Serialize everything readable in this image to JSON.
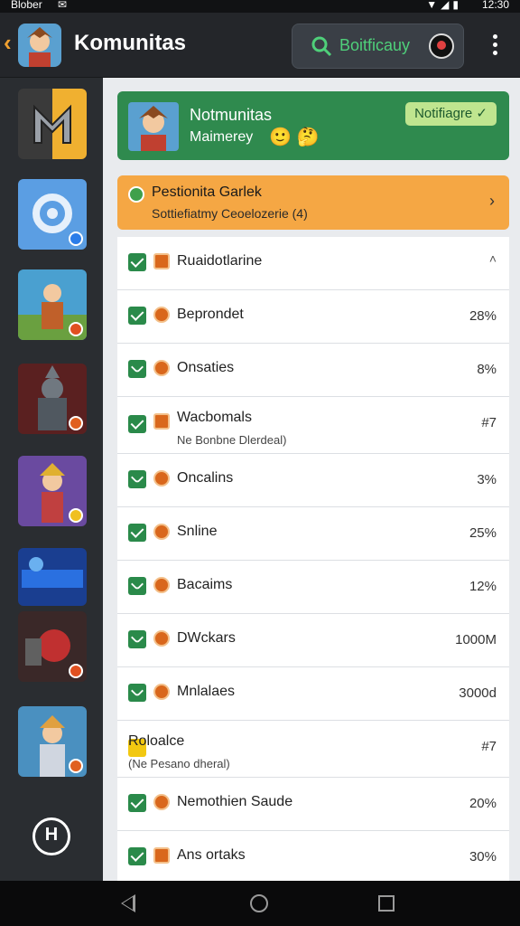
{
  "status_bar": {
    "carrier": "Blober",
    "message_icon": "message-icon",
    "icons": "wifi-icon signal-icon battery-icon",
    "time": "12:30"
  },
  "app_bar": {
    "title": "Komunitas",
    "search_label": "Boitficauy",
    "accent_color": "#f0a030"
  },
  "sidebar": {
    "items": [
      {
        "name": "game-m-icon",
        "colors": [
          "#3a3a3a",
          "#f0b030"
        ]
      },
      {
        "name": "gear-app-icon",
        "colors": [
          "#4a90d9",
          "#bcd7f4"
        ],
        "badge": "#2b7de9"
      },
      {
        "name": "warrior-game-icon",
        "colors": [
          "#4aa0d0",
          "#c0602a"
        ],
        "badge": "#e05020"
      },
      {
        "name": "armor-game-icon",
        "colors": [
          "#5a2020",
          "#c04030"
        ],
        "badge": "#e06020"
      },
      {
        "name": "hero-game-icon",
        "colors": [
          "#6a4aa0",
          "#e08040"
        ],
        "badge": "#f0c020"
      },
      {
        "name": "blue-game-icon",
        "colors": [
          "#1a4aa0",
          "#2a70e0"
        ]
      },
      {
        "name": "mech-game-icon",
        "colors": [
          "#3a2020",
          "#c03030"
        ],
        "badge": "#e05020"
      },
      {
        "name": "knight-game-icon",
        "colors": [
          "#4a90c0",
          "#e0a040"
        ],
        "badge": "#e06020"
      }
    ]
  },
  "banner": {
    "title": "Notmunitas",
    "subtitle": "Maimerey",
    "emoji": "🙂 🤔",
    "button": "Notifiagre ✓",
    "color": "#2f8a4e"
  },
  "promo": {
    "title": "Pestionita Garlek",
    "subtitle": "Sottiefiatmy Ceoelozerie (4)",
    "arrow": "›",
    "color": "#f5a744"
  },
  "list": [
    {
      "label": "Ruaidotlarine",
      "value": "˄",
      "check": "check",
      "icon": "square",
      "header": true
    },
    {
      "label": "Beprondet",
      "value": "28%",
      "check": "check",
      "icon": "round"
    },
    {
      "label": "Onsaties",
      "value": "8%",
      "check": "leaf",
      "icon": "round"
    },
    {
      "label": "Wacbomals",
      "sublabel": "Ne Bonbne Dlerdeal)",
      "value": "#7",
      "check": "check",
      "icon": "square",
      "tall": true
    },
    {
      "label": "Oncalins",
      "value": "3%",
      "check": "leaf",
      "icon": "round"
    },
    {
      "label": "Snline",
      "value": "25%",
      "check": "check",
      "icon": "round"
    },
    {
      "label": "Bacaims",
      "value": "12%",
      "check": "leaf",
      "icon": "round"
    },
    {
      "label": "DWckars",
      "value": "1000M",
      "check": "leaf",
      "icon": "round"
    },
    {
      "label": "Mnlalaes",
      "value": "3000d",
      "check": "leaf",
      "icon": "round"
    },
    {
      "label": "Roloalce",
      "sublabel": "(Ne Pesano dheral)",
      "value": "#7",
      "check": "yellow",
      "icon": "none",
      "tall": true
    },
    {
      "label": "Nemothien Saude",
      "value": "20%",
      "check": "check",
      "icon": "round"
    },
    {
      "label": "Ans ortaks",
      "value": "30%",
      "check": "check",
      "icon": "square"
    }
  ],
  "nav": {
    "back": "nav-back-icon",
    "home": "nav-home-icon",
    "recent": "nav-recents-icon"
  }
}
